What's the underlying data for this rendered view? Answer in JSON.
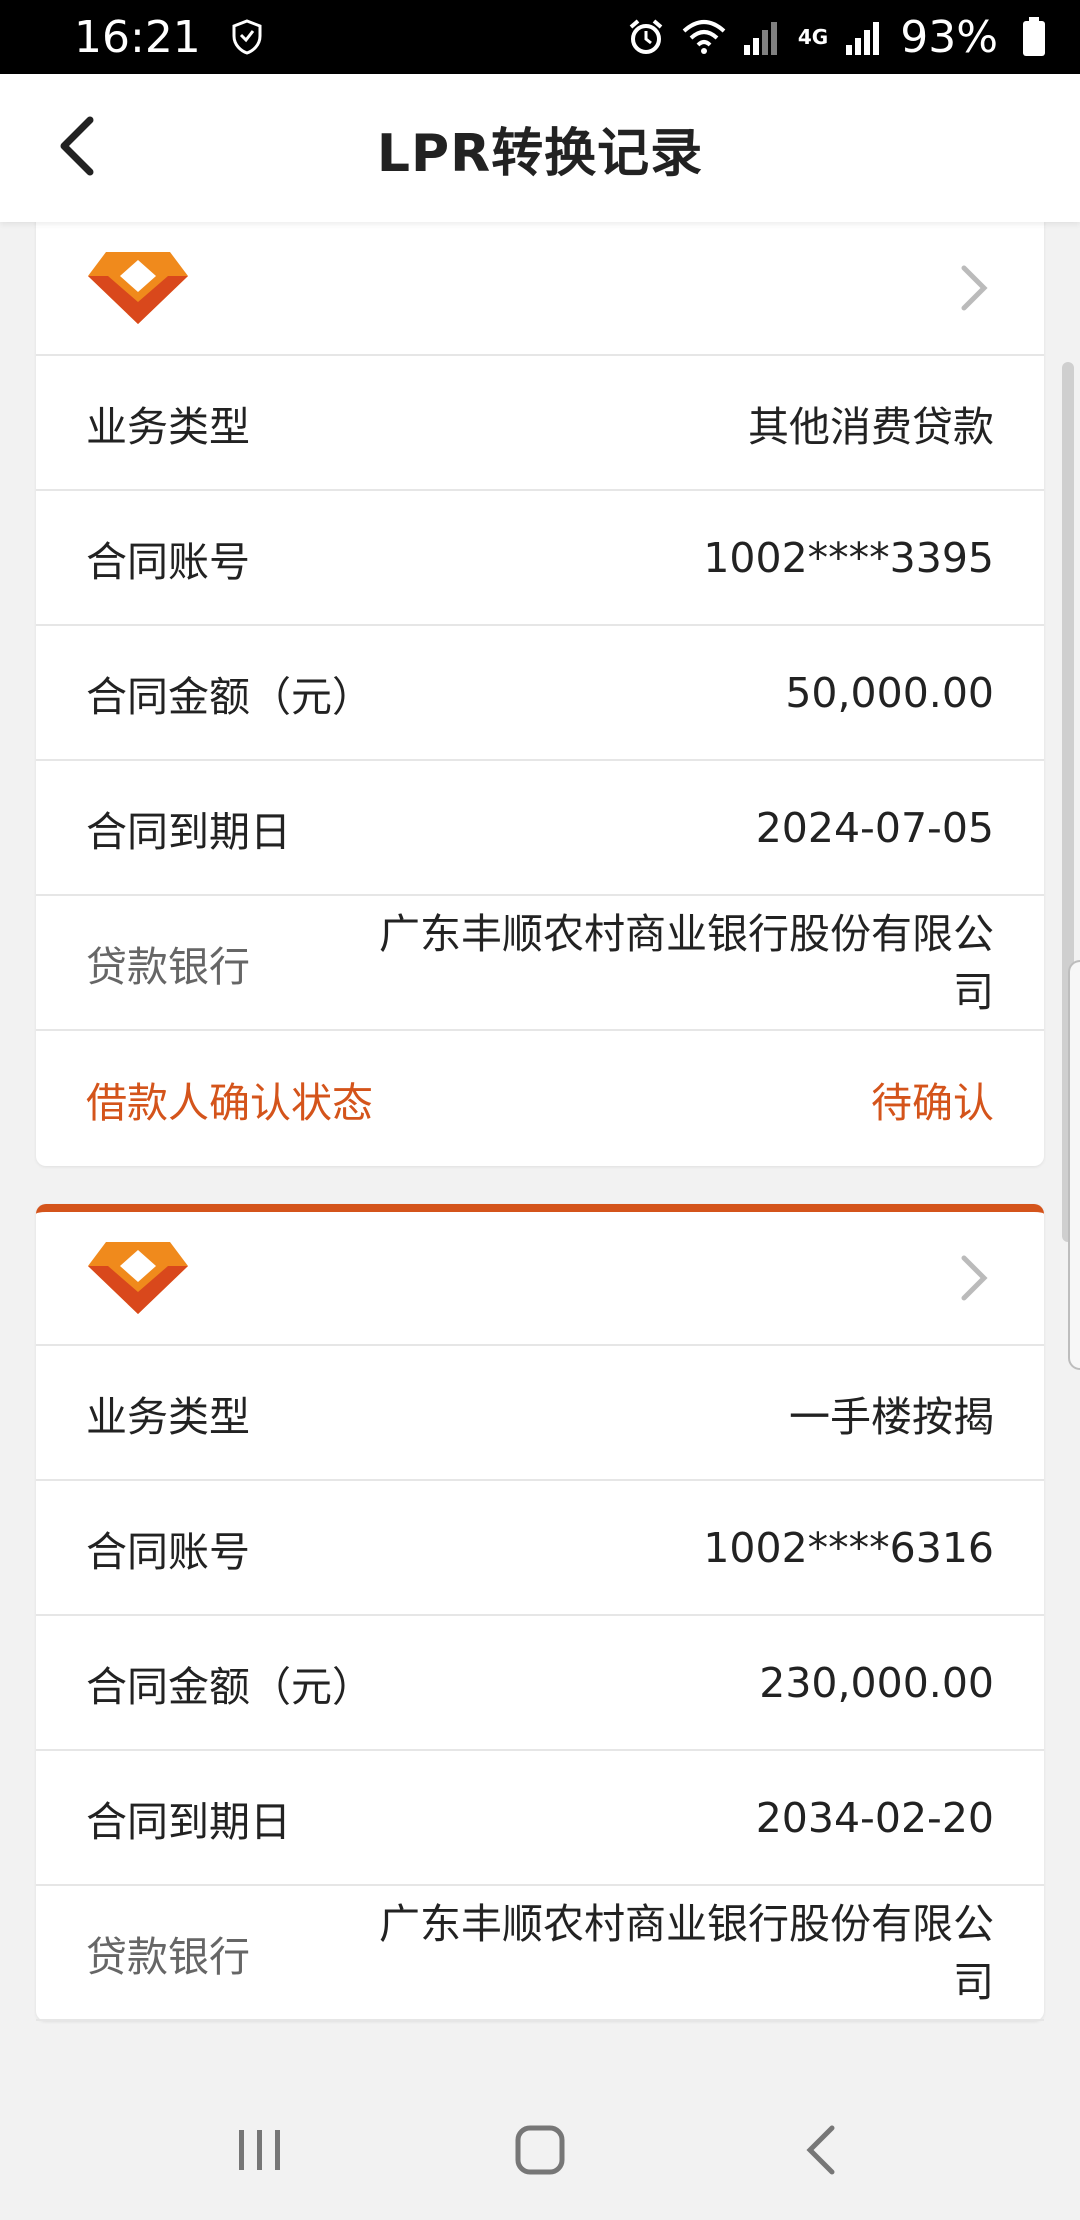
{
  "status_bar": {
    "time": "16:21",
    "battery": "93%",
    "network": "4G",
    "icons": [
      "shield-icon",
      "alarm-icon",
      "wifi-icon",
      "signal-icon",
      "battery-icon"
    ]
  },
  "header": {
    "title": "LPR转换记录",
    "back_icon": "chevron-left-icon"
  },
  "records": [
    {
      "business_type_label": "业务类型",
      "business_type": "其他消费贷款",
      "account_label": "合同账号",
      "account": "1002****3395",
      "amount_label": "合同金额（元）",
      "amount": "50,000.00",
      "due_label": "合同到期日",
      "due_date": "2024-07-05",
      "bank_label": "贷款银行",
      "bank": "广东丰顺农村商业银行股份有限公司",
      "status_label": "借款人确认状态",
      "status": "待确认"
    },
    {
      "business_type_label": "业务类型",
      "business_type": "一手楼按揭",
      "account_label": "合同账号",
      "account": "1002****6316",
      "amount_label": "合同金额（元）",
      "amount": "230,000.00",
      "due_label": "合同到期日",
      "due_date": "2034-02-20",
      "bank_label": "贷款银行",
      "bank": "广东丰顺农村商业银行股份有限公司"
    }
  ],
  "colors": {
    "accent": "#d4541b",
    "logo_orange": "#f08a1c",
    "logo_red": "#d9481c"
  },
  "nav": {
    "icons": [
      "recents-icon",
      "home-icon",
      "back-icon"
    ]
  }
}
